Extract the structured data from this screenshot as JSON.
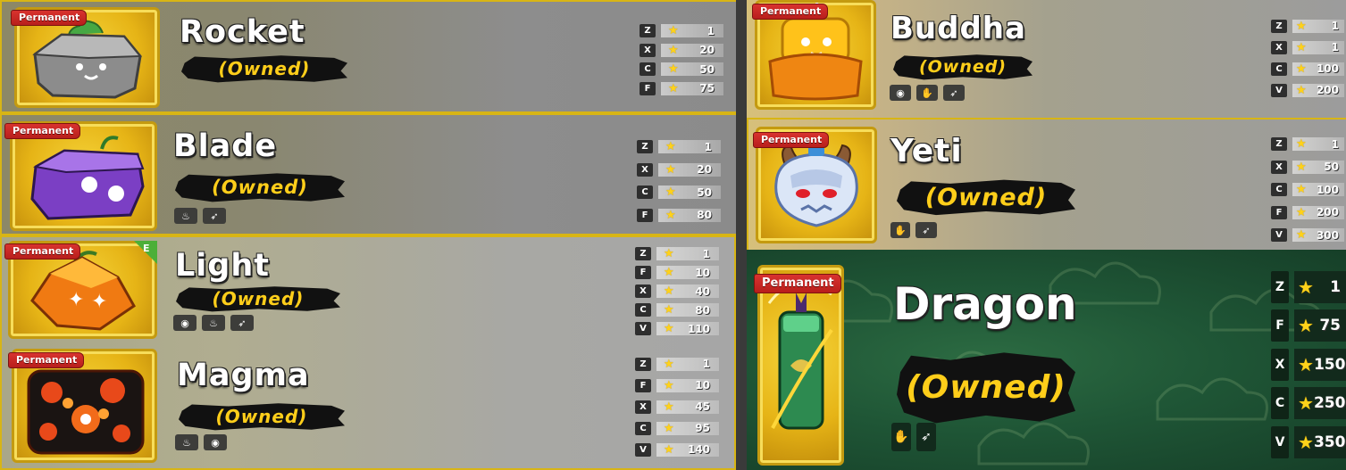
{
  "badge_text": "Permanent",
  "owned_text": "(Owned)",
  "colors": {
    "accent_gold": "#d8b515",
    "ribbon_red": "#c42622",
    "owned_yellow": "#ffce1a",
    "dragon_green": "#1f5636"
  },
  "fruits": [
    {
      "name": "Rocket",
      "abilities": [],
      "stats": [
        {
          "key": "Z",
          "value": "1"
        },
        {
          "key": "X",
          "value": "20"
        },
        {
          "key": "C",
          "value": "50"
        },
        {
          "key": "F",
          "value": "75"
        }
      ]
    },
    {
      "name": "Blade",
      "abilities": [
        "fire-icon",
        "wind-icon"
      ],
      "stats": [
        {
          "key": "Z",
          "value": "1"
        },
        {
          "key": "X",
          "value": "20"
        },
        {
          "key": "C",
          "value": "50"
        },
        {
          "key": "F",
          "value": "80"
        }
      ]
    },
    {
      "name": "Light",
      "edition": "E",
      "abilities": [
        "eye-icon",
        "fire-icon",
        "wind-icon"
      ],
      "stats": [
        {
          "key": "Z",
          "value": "1"
        },
        {
          "key": "F",
          "value": "10"
        },
        {
          "key": "X",
          "value": "40"
        },
        {
          "key": "C",
          "value": "80"
        },
        {
          "key": "V",
          "value": "110"
        }
      ]
    },
    {
      "name": "Magma",
      "abilities": [
        "fire-icon",
        "eye-icon"
      ],
      "stats": [
        {
          "key": "Z",
          "value": "1"
        },
        {
          "key": "F",
          "value": "10"
        },
        {
          "key": "X",
          "value": "45"
        },
        {
          "key": "C",
          "value": "95"
        },
        {
          "key": "V",
          "value": "140"
        }
      ]
    },
    {
      "name": "Buddha",
      "abilities": [
        "eye-icon",
        "claw-icon",
        "wind-icon"
      ],
      "stats": [
        {
          "key": "Z",
          "value": "1"
        },
        {
          "key": "X",
          "value": "1"
        },
        {
          "key": "C",
          "value": "100"
        },
        {
          "key": "V",
          "value": "200"
        }
      ]
    },
    {
      "name": "Yeti",
      "abilities": [
        "claw-icon",
        "wind-icon"
      ],
      "stats": [
        {
          "key": "Z",
          "value": "1"
        },
        {
          "key": "X",
          "value": "50"
        },
        {
          "key": "C",
          "value": "100"
        },
        {
          "key": "F",
          "value": "200"
        },
        {
          "key": "V",
          "value": "300"
        }
      ]
    },
    {
      "name": "Dragon",
      "abilities": [
        "claw-icon",
        "wind-icon"
      ],
      "stats": [
        {
          "key": "Z",
          "value": "1"
        },
        {
          "key": "F",
          "value": "75"
        },
        {
          "key": "X",
          "value": "150"
        },
        {
          "key": "C",
          "value": "250"
        },
        {
          "key": "V",
          "value": "350"
        }
      ]
    }
  ]
}
